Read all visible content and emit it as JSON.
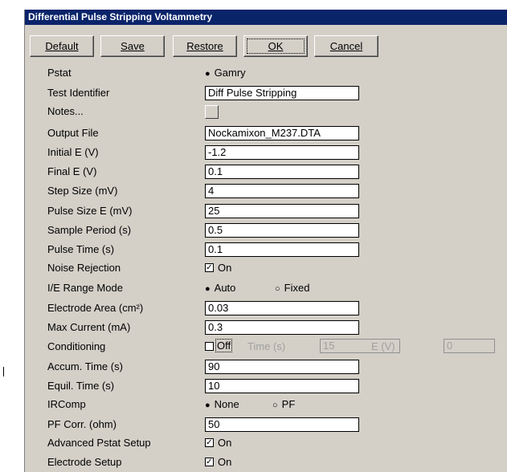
{
  "window": {
    "title": "Differential Pulse Stripping Voltammetry"
  },
  "buttons": {
    "default": "Default",
    "save": "Save",
    "restore": "Restore",
    "ok": "OK",
    "cancel": "Cancel"
  },
  "fields": {
    "pstat": {
      "label": "Pstat",
      "option": "Gamry"
    },
    "test_identifier": {
      "label": "Test Identifier",
      "value": "Diff Pulse Stripping"
    },
    "notes": {
      "label": "Notes..."
    },
    "output_file": {
      "label": "Output File",
      "value": "Nockamixon_M237.DTA"
    },
    "initial_e": {
      "label": "Initial E (V)",
      "value": "-1.2"
    },
    "final_e": {
      "label": "Final E (V)",
      "value": "0.1"
    },
    "step_size": {
      "label": "Step Size (mV)",
      "value": "4"
    },
    "pulse_size": {
      "label": "Pulse Size E (mV)",
      "value": "25"
    },
    "sample_period": {
      "label": "Sample Period (s)",
      "value": "0.5"
    },
    "pulse_time": {
      "label": "Pulse Time (s)",
      "value": "0.1"
    },
    "noise_rejection": {
      "label": "Noise Rejection",
      "checkbox_label": "On"
    },
    "ie_range_mode": {
      "label": "I/E Range Mode",
      "option_auto": "Auto",
      "option_fixed": "Fixed"
    },
    "electrode_area": {
      "label": "Electrode Area (cm²)",
      "value": "0.03"
    },
    "max_current": {
      "label": "Max Current (mA)",
      "value": "0.3"
    },
    "conditioning": {
      "label": "Conditioning",
      "checkbox_label": "Off",
      "time_label": "Time (s)",
      "time_value": "15",
      "e_label": "E (V)",
      "e_value": "0"
    },
    "accum_time": {
      "label": "Accum. Time (s)",
      "value": "90"
    },
    "equil_time": {
      "label": "Equil. Time (s)",
      "value": "10"
    },
    "ircomp": {
      "label": "IRComp",
      "option_none": "None",
      "option_pf": "PF"
    },
    "pf_corr": {
      "label": "PF Corr. (ohm)",
      "value": "50"
    },
    "advanced_pstat": {
      "label": "Advanced Pstat Setup",
      "checkbox_label": "On"
    },
    "electrode_setup": {
      "label": "Electrode Setup",
      "checkbox_label": "On"
    }
  }
}
